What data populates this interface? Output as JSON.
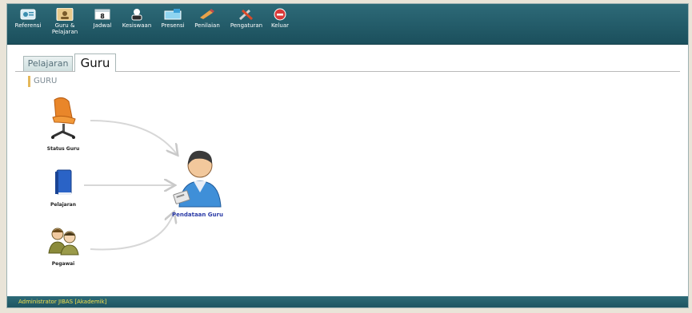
{
  "toolbar": {
    "items": [
      {
        "label": "Referensi",
        "icon": "referensi-icon"
      },
      {
        "label": "Guru &\nPelajaran",
        "icon": "guru-pelajaran-icon"
      },
      {
        "label": "Jadwal",
        "icon": "jadwal-icon",
        "badge": "8"
      },
      {
        "label": "Kesiswaan",
        "icon": "kesiswaan-icon"
      },
      {
        "label": "Presensi",
        "icon": "presensi-icon"
      },
      {
        "label": "Penilaian",
        "icon": "penilaian-icon"
      },
      {
        "label": "Pengaturan",
        "icon": "pengaturan-icon"
      },
      {
        "label": "Keluar",
        "icon": "keluar-icon"
      }
    ]
  },
  "tabs": [
    {
      "label": "Pelajaran",
      "active": false
    },
    {
      "label": "Guru",
      "active": true
    }
  ],
  "section": {
    "title": "GURU"
  },
  "diagram": {
    "nodes": [
      {
        "label": "Status Guru",
        "icon": "office-chair-icon"
      },
      {
        "label": "Pelajaran",
        "icon": "book-icon"
      },
      {
        "label": "Pegawai",
        "icon": "people-icon"
      }
    ],
    "target": {
      "label": "Pendataan Guru",
      "icon": "teacher-person-icon"
    }
  },
  "statusbar": {
    "text": "Administrator JIBAS [Akademik]"
  },
  "colors": {
    "toolbar": "#1f5663",
    "statusbar_text": "#f4e04a",
    "target_label": "#2a3aa6",
    "section_accent": "#e5b85a"
  }
}
